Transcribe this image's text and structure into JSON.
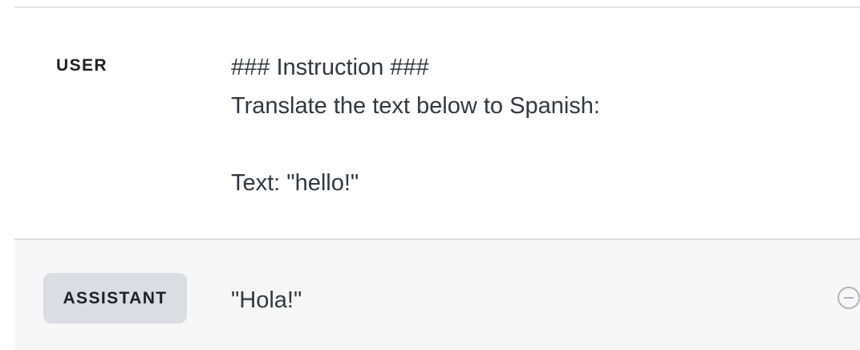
{
  "messages": [
    {
      "role": "USER",
      "lines": [
        "### Instruction ###",
        "Translate the text below to Spanish:",
        "",
        "Text: \"hello!\""
      ]
    },
    {
      "role": "ASSISTANT",
      "lines": [
        "\"Hola!\""
      ]
    }
  ],
  "icons": {
    "remove_message": "minus-circle-icon"
  },
  "colors": {
    "assistant_row_background": "#f7f7f8",
    "role_pill_background": "#dcdce3",
    "text": "#353740",
    "icon": "#b4b4bc"
  }
}
